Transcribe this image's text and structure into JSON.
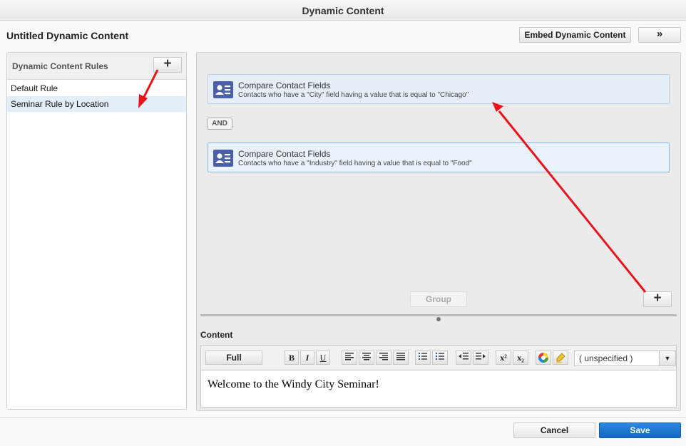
{
  "window": {
    "title": "Dynamic Content"
  },
  "header": {
    "doc_title": "Untitled Dynamic Content",
    "embed_label": "Embed Dynamic Content",
    "expand_label": "»"
  },
  "rules_panel": {
    "title": "Dynamic Content Rules",
    "add_label": "+",
    "items": [
      {
        "label": "Default Rule"
      },
      {
        "label": "Seminar Rule by Location",
        "selected": true
      }
    ]
  },
  "criteria": [
    {
      "title": "Compare Contact Fields",
      "description": "Contacts who have a \"City\" field having a value that is equal to \"Chicago\""
    },
    {
      "title": "Compare Contact Fields",
      "description": "Contacts who have a \"Industry\" field having a value that is equal to \"Food\""
    }
  ],
  "operator": "AND",
  "group_label": "Group",
  "add_criteria_label": "+",
  "content": {
    "label": "Content",
    "toolbar": {
      "full_label": "Full",
      "bold": "B",
      "italic": "I",
      "underline": "U",
      "superscript": "x²",
      "subscript": "x₂",
      "font_select_value": "( unspecified )",
      "dropdown_arrow": "▼"
    },
    "body_text": "Welcome to the Windy City Seminar!"
  },
  "footer": {
    "cancel_label": "Cancel",
    "save_label": "Save"
  },
  "colors": {
    "accent": "#1a6fce",
    "annotation_arrow": "#e8141b",
    "contact_icon": "#4a5fa8"
  }
}
